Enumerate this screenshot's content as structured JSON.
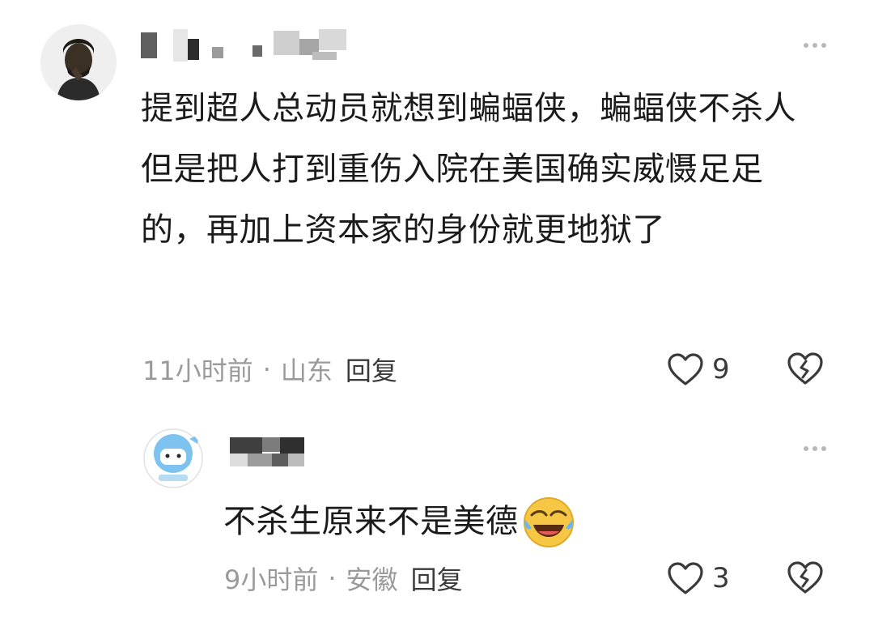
{
  "comments": [
    {
      "text": "提到超人总动员就想到蝙蝠侠，蝙蝠侠不杀人但是把人打到重伤入院在美国确实威慑足足的，再加上资本家的身份就更地狱了",
      "time": "11小时前",
      "location": "山东",
      "reply_label": "回复",
      "likes": "9",
      "icons": {
        "more": "more-icon",
        "like": "heart-icon",
        "dislike": "broken-heart-icon"
      }
    }
  ],
  "replies": [
    {
      "text": "不杀生原来不是美德",
      "emoji": "laughing-crying-face",
      "time": "9小时前",
      "location": "安徽",
      "reply_label": "回复",
      "likes": "3",
      "icons": {
        "more": "more-icon",
        "like": "heart-icon",
        "dislike": "broken-heart-icon"
      }
    }
  ],
  "separator": "·",
  "colors": {
    "text": "#1b1b1b",
    "meta": "#9a9a9a",
    "icon": "#3a3a3a",
    "avatar2": "#7ec3f0",
    "emoji": "#f6c744"
  }
}
